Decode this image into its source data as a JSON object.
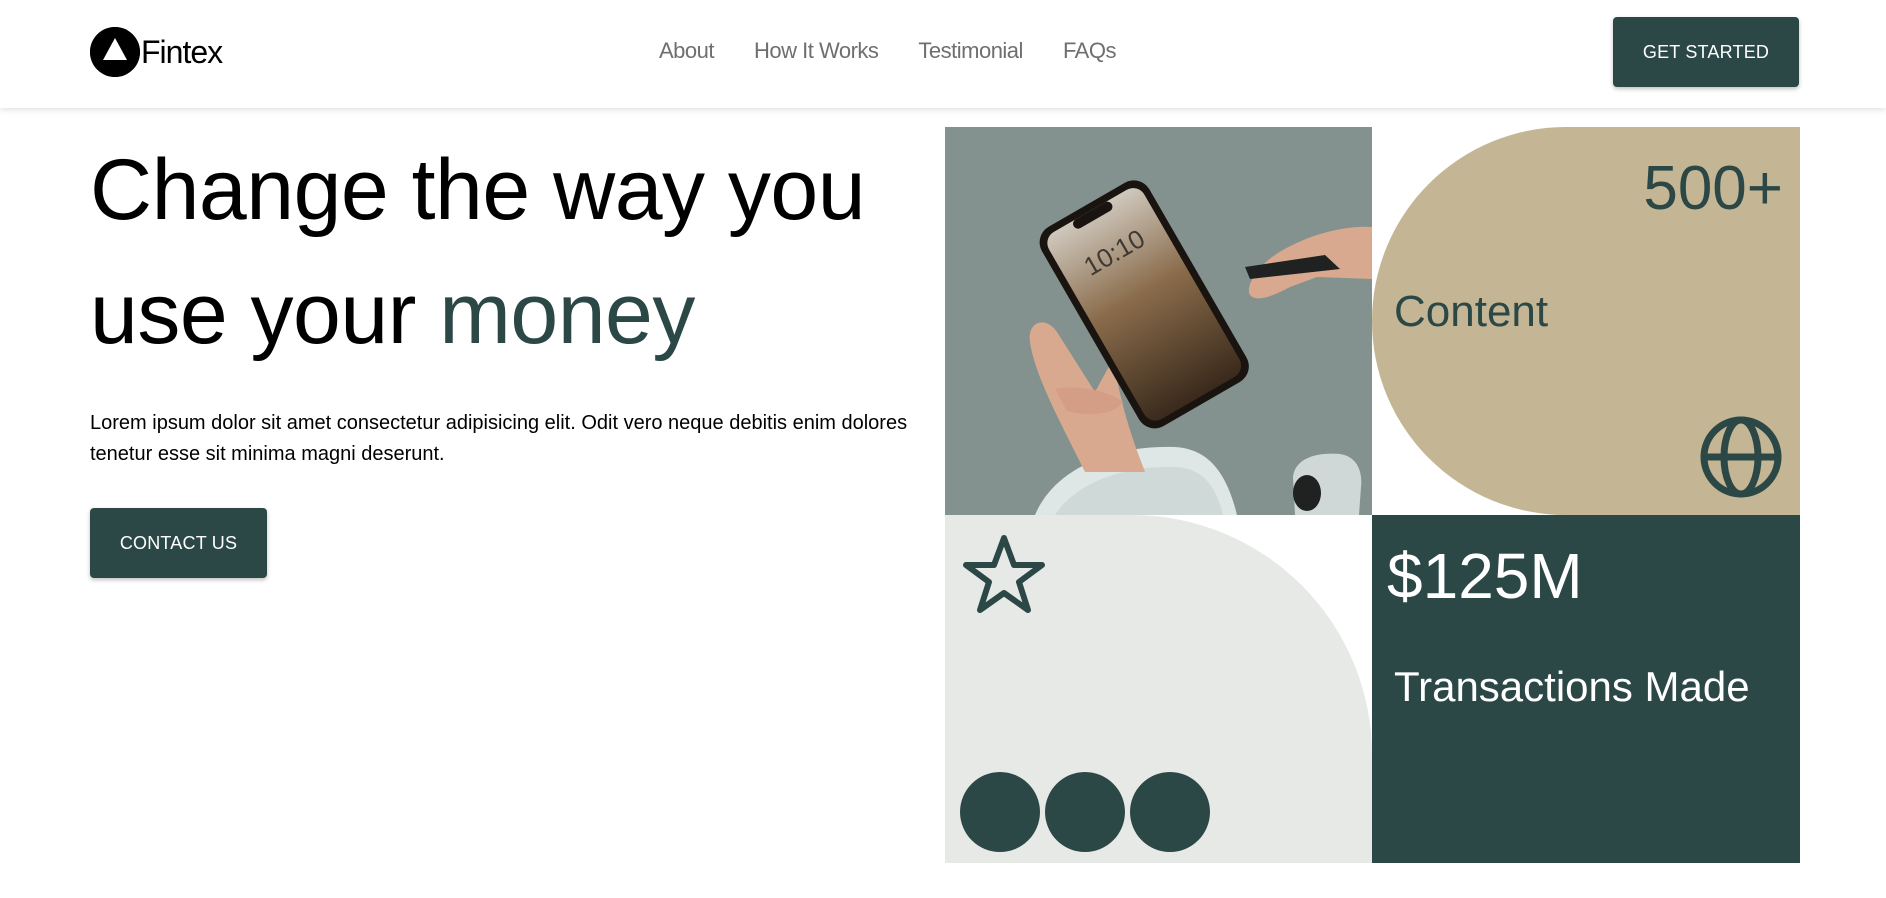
{
  "brand": {
    "name": "Fintex",
    "logo_icon": "triangle-in-circle-icon"
  },
  "nav": {
    "items": [
      {
        "label": "About"
      },
      {
        "label": "How It Works"
      },
      {
        "label": "Testimonial"
      },
      {
        "label": "FAQs"
      }
    ],
    "cta_label": "GET STARTED"
  },
  "hero": {
    "title_line1": "Change the way you",
    "title_line2_prefix": "use your ",
    "title_accent": "money",
    "description": "Lorem ipsum dolor sit amet consectetur adipisicing elit. Odit vero neque debitis enim dolores tenetur esse sit minima magni deserunt.",
    "cta_label": "CONTACT US"
  },
  "phone_display": {
    "time": "10:10"
  },
  "stats": {
    "content": {
      "value": "500+",
      "label": "Content",
      "icon": "globe-icon"
    },
    "transactions": {
      "value": "$125M",
      "label": "Transactions Made"
    },
    "rating_icon": "star-icon"
  },
  "colors": {
    "primary": "#2b4846",
    "sand": "#c4b694",
    "light_gray": "#e7e9e6",
    "photo_bg": "#83928f",
    "nav_text": "#6f6f6f"
  }
}
